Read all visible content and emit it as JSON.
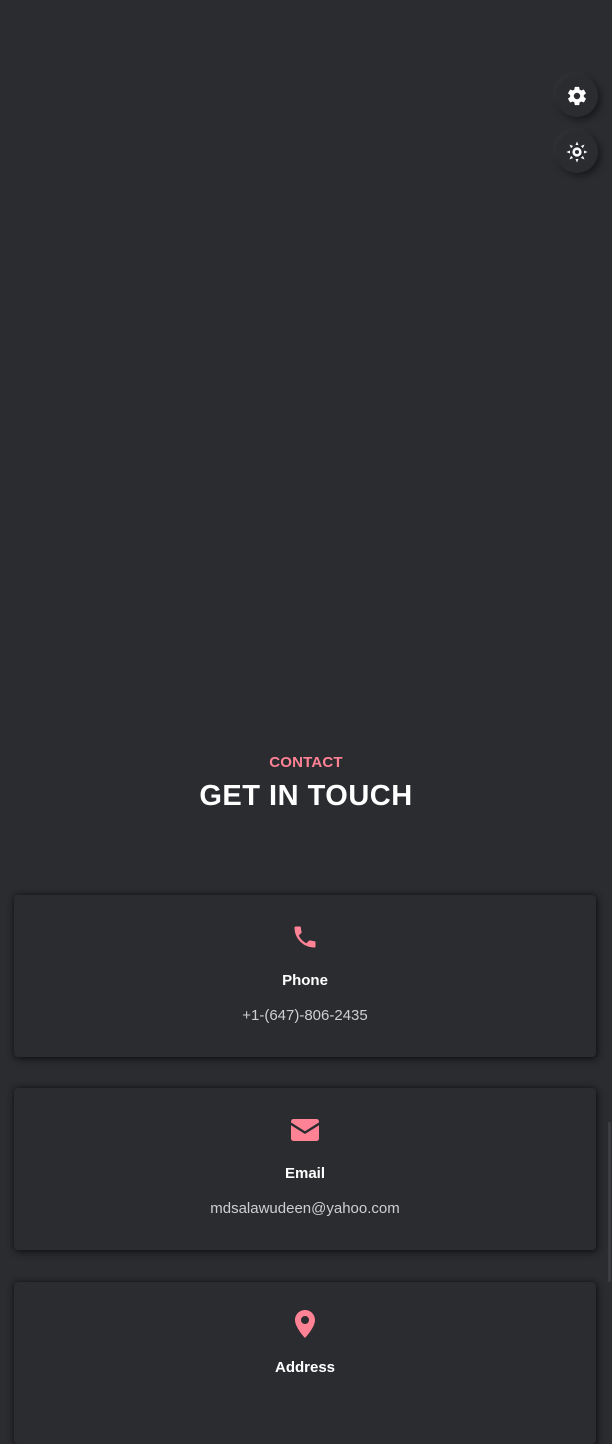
{
  "floating_controls": {
    "settings_icon": "gear-icon",
    "theme_icon": "sun-icon"
  },
  "contact": {
    "eyebrow": "CONTACT",
    "title": "GET IN TOUCH",
    "accent_color": "#ff8295",
    "cards": [
      {
        "icon": "phone-icon",
        "label": "Phone",
        "value": "+1-(647)-806-2435"
      },
      {
        "icon": "envelope-icon",
        "label": "Email",
        "value": "mdsalawudeen@yahoo.com"
      },
      {
        "icon": "map-marker-icon",
        "label": "Address",
        "value": ""
      }
    ]
  }
}
